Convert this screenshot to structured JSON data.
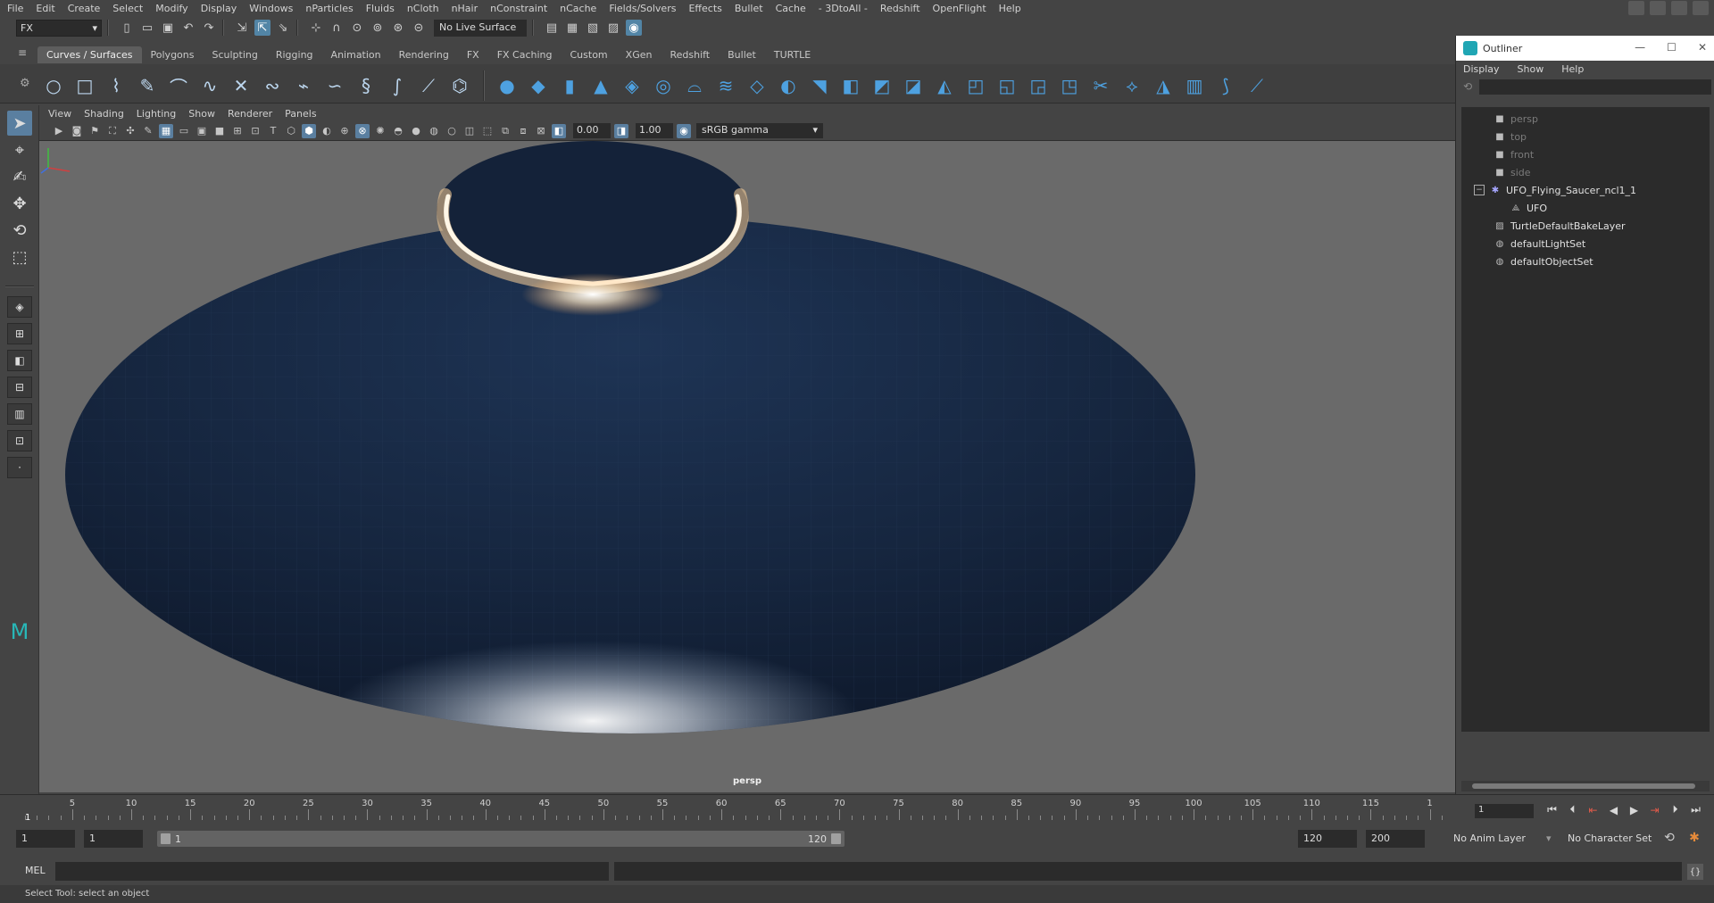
{
  "menubar": {
    "items": [
      "File",
      "Edit",
      "Create",
      "Select",
      "Modify",
      "Display",
      "Windows",
      "nParticles",
      "Fluids",
      "nCloth",
      "nHair",
      "nConstraint",
      "nCache",
      "Fields/Solvers",
      "Effects",
      "Bullet",
      "Cache",
      "- 3DtoAll -",
      "Redshift",
      "OpenFlight",
      "Help"
    ]
  },
  "statusline": {
    "mode": "FX",
    "live_surface": "No Live Surface"
  },
  "shelf": {
    "tabs": [
      "Curves / Surfaces",
      "Polygons",
      "Sculpting",
      "Rigging",
      "Animation",
      "Rendering",
      "FX",
      "FX Caching",
      "Custom",
      "XGen",
      "Redshift",
      "Bullet",
      "TURTLE"
    ],
    "active_tab": "Curves / Surfaces",
    "icons_left": [
      "circle-icon",
      "square-icon",
      "ep-curve-icon",
      "pencil-curve-icon",
      "bezier-icon",
      "arc-icon",
      "curve-intersect-icon",
      "attach-curve-icon",
      "detach-curve-icon",
      "fillet-icon",
      "insert-knot-icon",
      "extend-icon",
      "offset-icon",
      "rebuild-icon",
      "reverse-icon"
    ],
    "icons_right": [
      "nurbs-sphere-icon",
      "nurbs-cube-icon",
      "nurbs-cylinder-icon",
      "nurbs-cone-icon",
      "nurbs-plane-icon",
      "nurbs-torus-icon",
      "revolve-icon",
      "loft-icon",
      "planar-icon",
      "extrude-icon",
      "birail-icon",
      "boundary-icon",
      "square-surface-icon",
      "bevel-icon",
      "intersect-icon",
      "project-icon",
      "trim-icon",
      "untrim-icon",
      "attach-icon",
      "detach-icon",
      "align-icon",
      "open-close-icon",
      "rebuild-surface-icon",
      "sculpt-icon",
      "stitch-icon"
    ]
  },
  "viewport": {
    "menu": [
      "View",
      "Shading",
      "Lighting",
      "Show",
      "Renderer",
      "Panels"
    ],
    "exposure": "0.00",
    "gamma": "1.00",
    "color_space": "sRGB gamma",
    "camera_label": "persp"
  },
  "outliner": {
    "title": "Outliner",
    "menu": [
      "Display",
      "Show",
      "Help"
    ],
    "items": [
      {
        "label": "persp",
        "icon": "camera-icon",
        "dim": true
      },
      {
        "label": "top",
        "icon": "camera-icon",
        "dim": true
      },
      {
        "label": "front",
        "icon": "camera-icon",
        "dim": true
      },
      {
        "label": "side",
        "icon": "camera-icon",
        "dim": true
      },
      {
        "label": "UFO_Flying_Saucer_ncl1_1",
        "icon": "group-icon",
        "dim": false
      },
      {
        "label": "UFO",
        "icon": "mesh-icon",
        "dim": false
      },
      {
        "label": "TurtleDefaultBakeLayer",
        "icon": "bake-layer-icon",
        "dim": false
      },
      {
        "label": "defaultLightSet",
        "icon": "set-icon",
        "dim": false
      },
      {
        "label": "defaultObjectSet",
        "icon": "set-icon",
        "dim": false
      }
    ]
  },
  "timeline": {
    "current_frame": "1",
    "tick_labels": [
      "5",
      "10",
      "15",
      "20",
      "25",
      "30",
      "35",
      "40",
      "45",
      "50",
      "55",
      "60",
      "65",
      "70",
      "75",
      "80",
      "85",
      "90",
      "95",
      "100",
      "105",
      "110",
      "115",
      "1"
    ],
    "frame_field": "1"
  },
  "range": {
    "start": "1",
    "playback_start": "1",
    "slider_start": "1",
    "slider_end": "120",
    "playback_end": "120",
    "end": "200",
    "anim_layer": "No Anim Layer",
    "character_set": "No Character Set"
  },
  "command": {
    "mel_label": "MEL"
  },
  "help_line": "Select Tool: select an object",
  "colors": {
    "accent": "#5285a6",
    "viewport_bg": "#6a6a6a",
    "saucer_body": "#1a2a44",
    "shelf_icon": "#4ea1e0"
  }
}
